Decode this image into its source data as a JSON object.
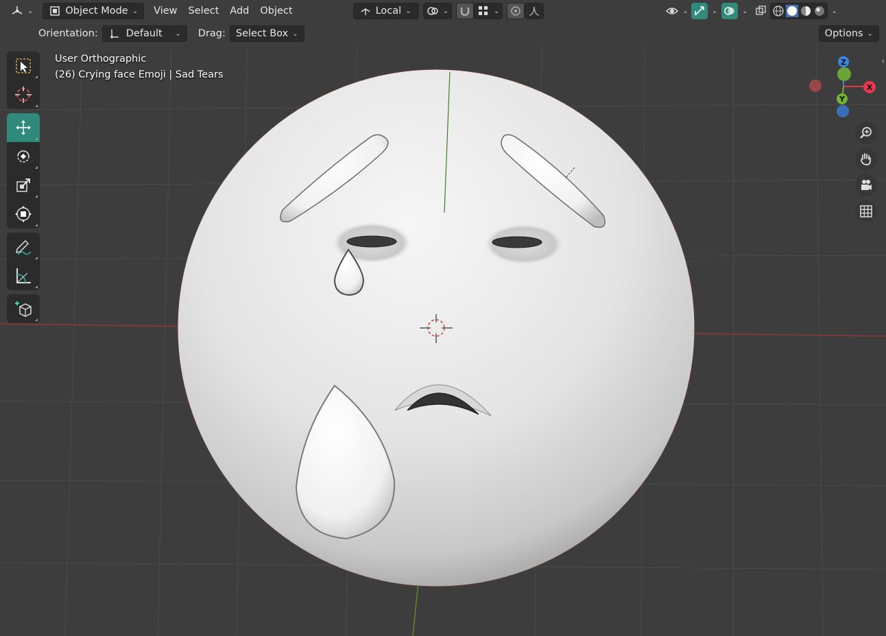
{
  "header": {
    "editor_type_icon": "3d-viewport-icon",
    "mode_label": "Object Mode",
    "menus": [
      "View",
      "Select",
      "Add",
      "Object"
    ],
    "transform_orientation_label": "Local",
    "snap_icon": "magnet-icon",
    "proportional_icon": "falloff-curve-icon",
    "shading_modes": [
      "wireframe",
      "solid",
      "material-preview",
      "rendered"
    ]
  },
  "tool_settings": {
    "orientation_label": "Orientation:",
    "orientation_value": "Default",
    "drag_label": "Drag:",
    "drag_value": "Select Box",
    "options_label": "Options"
  },
  "toolbar": {
    "tools": [
      "select-box",
      "cursor",
      "move",
      "rotate",
      "scale",
      "transform",
      "annotate",
      "measure",
      "add-cube"
    ],
    "active_tool": "move",
    "accent_color": "#2f8a7b"
  },
  "viewport": {
    "view_name": "User Orthographic",
    "object_info": "(26) Crying face Emoji | Sad Tears",
    "background_color": "#3d3d3d",
    "grid_color": "#4b4b4b",
    "x_axis_color": "#8a3a3a",
    "y_axis_color": "#5a8a2a"
  },
  "gizmo": {
    "x_label": "X",
    "y_label": "Y",
    "z_label": "Z",
    "x_color": "#e03a4b",
    "y_color": "#72b32f",
    "z_color": "#3a86e0"
  },
  "nav_buttons": [
    "zoom-icon",
    "hand-pan-icon",
    "camera-icon",
    "grid-ortho-icon"
  ]
}
